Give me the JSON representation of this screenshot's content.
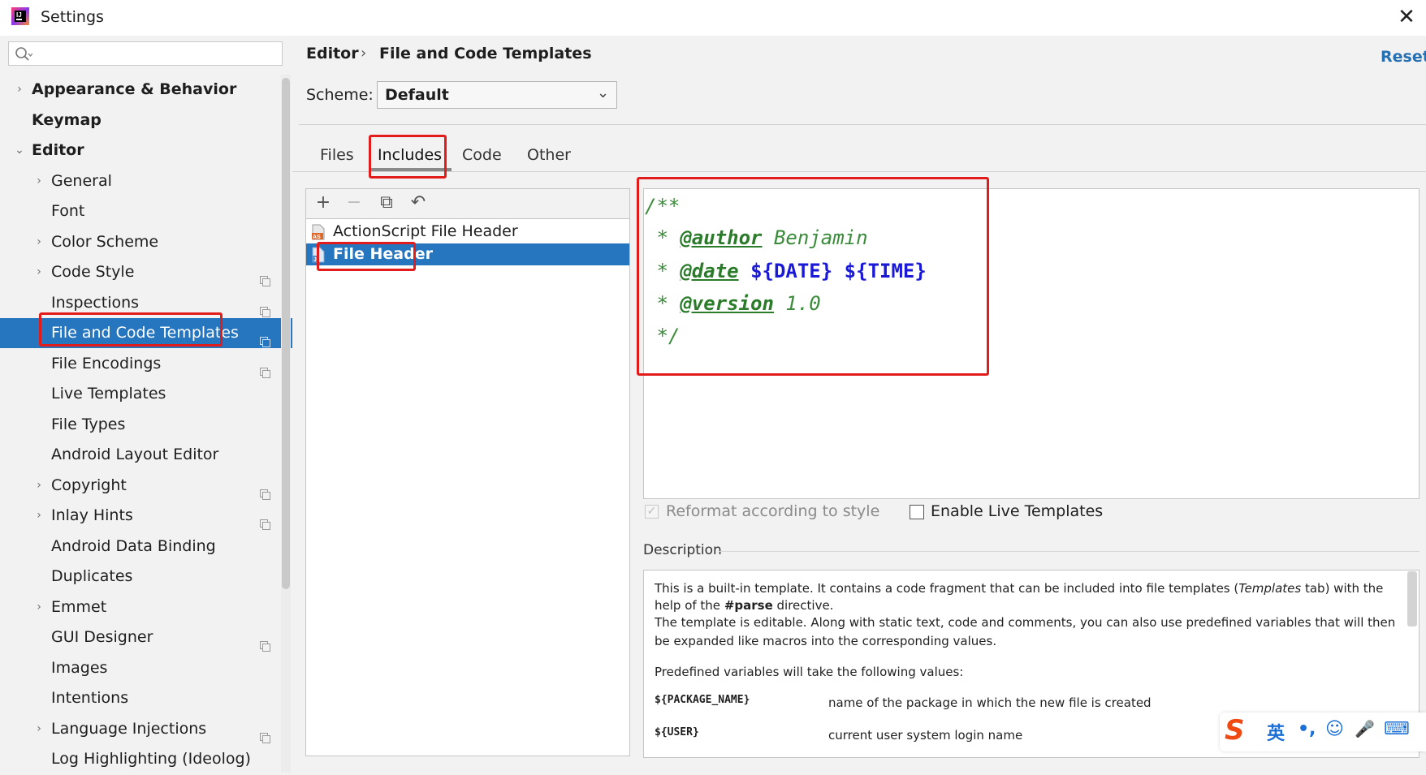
{
  "window": {
    "title": "Settings",
    "close_glyph": "✕"
  },
  "icons": {
    "app": "intellij-app-icon",
    "search": "search-icon",
    "close": "close-icon",
    "project": "project-scope-icon"
  },
  "colors": {
    "selection": "#2675bf",
    "highlight": "#e21b1b",
    "link": "#2470b3",
    "comment": "#3a8c3a",
    "variable": "#1a1ad6"
  },
  "sidebar": {
    "search_placeholder": "",
    "items": [
      {
        "label": "Appearance & Behavior",
        "bold": true,
        "arrow": "›",
        "level": 0
      },
      {
        "label": "Keymap",
        "bold": true,
        "arrow": "",
        "level": 0
      },
      {
        "label": "Editor",
        "bold": true,
        "arrow": "⌄",
        "level": 0
      },
      {
        "label": "General",
        "arrow": "›",
        "level": 1
      },
      {
        "label": "Font",
        "arrow": "",
        "level": 1
      },
      {
        "label": "Color Scheme",
        "arrow": "›",
        "level": 1
      },
      {
        "label": "Code Style",
        "arrow": "›",
        "level": 1,
        "project": true
      },
      {
        "label": "Inspections",
        "arrow": "",
        "level": 1,
        "project": true
      },
      {
        "label": "File and Code Templates",
        "arrow": "",
        "level": 1,
        "project": true,
        "selected": true
      },
      {
        "label": "File Encodings",
        "arrow": "",
        "level": 1,
        "project": true
      },
      {
        "label": "Live Templates",
        "arrow": "",
        "level": 1
      },
      {
        "label": "File Types",
        "arrow": "",
        "level": 1
      },
      {
        "label": "Android Layout Editor",
        "arrow": "",
        "level": 1
      },
      {
        "label": "Copyright",
        "arrow": "›",
        "level": 1,
        "project": true
      },
      {
        "label": "Inlay Hints",
        "arrow": "›",
        "level": 1,
        "project": true
      },
      {
        "label": "Android Data Binding",
        "arrow": "",
        "level": 1
      },
      {
        "label": "Duplicates",
        "arrow": "",
        "level": 1
      },
      {
        "label": "Emmet",
        "arrow": "›",
        "level": 1
      },
      {
        "label": "GUI Designer",
        "arrow": "",
        "level": 1,
        "project": true
      },
      {
        "label": "Images",
        "arrow": "",
        "level": 1
      },
      {
        "label": "Intentions",
        "arrow": "",
        "level": 1
      },
      {
        "label": "Language Injections",
        "arrow": "›",
        "level": 1,
        "project": true
      },
      {
        "label": "Log Highlighting (Ideolog)",
        "arrow": "",
        "level": 1
      }
    ]
  },
  "header": {
    "crumb_parent": "Editor",
    "crumb_sep": "›",
    "crumb_page": "File and Code Templates",
    "reset": "Reset"
  },
  "scheme": {
    "label": "Scheme:",
    "value": "Default",
    "chevron": "⌄"
  },
  "tabs": [
    {
      "label": "Files"
    },
    {
      "label": "Includes",
      "active": true
    },
    {
      "label": "Code"
    },
    {
      "label": "Other"
    }
  ],
  "toolbar": {
    "add": "+",
    "remove": "−",
    "copy": "⧉",
    "reset": "↶"
  },
  "templates": [
    {
      "label": "ActionScript File Header",
      "icon": "as-file-icon"
    },
    {
      "label": "File Header",
      "icon": "java-file-icon",
      "selected": true
    }
  ],
  "editor": {
    "line1": "/**",
    "line2_prefix": " * ",
    "line2_tag": "@author",
    "line2_text": " Benjamin",
    "line3_prefix": " * ",
    "line3_tag": "@date",
    "line3_sp": " ",
    "line3_var1": "${DATE}",
    "line3_sp2": " ",
    "line3_var2": "${TIME}",
    "line4_prefix": " * ",
    "line4_tag": "@version",
    "line4_text": " 1.0",
    "line5": " */"
  },
  "options": {
    "reformat_label": "Reformat according to style",
    "reformat_checked": true,
    "live_label": "Enable Live Templates",
    "live_checked": false
  },
  "description": {
    "title": "Description",
    "p1a": "This is a built-in template. It contains a code fragment that can be included into file templates (",
    "p1b": "Templates",
    "p1c": " tab) with the",
    "p2a": "help of the ",
    "p2b": "#parse",
    "p2c": " directive.",
    "p3": "The template is editable. Along with static text, code and comments, you can also use predefined variables that will then",
    "p4": "be expanded like macros into the corresponding values.",
    "p5": "Predefined variables will take the following values:",
    "vars": [
      {
        "name": "${PACKAGE_NAME}",
        "desc": "name of the package in which the new file is created"
      },
      {
        "name": "${USER}",
        "desc": "current user system login name"
      }
    ]
  },
  "ime": {
    "logo": "S",
    "lang": "英",
    "punct": "•,",
    "emoji": "☺",
    "mic": "🎤",
    "keyboard": "⌨"
  }
}
